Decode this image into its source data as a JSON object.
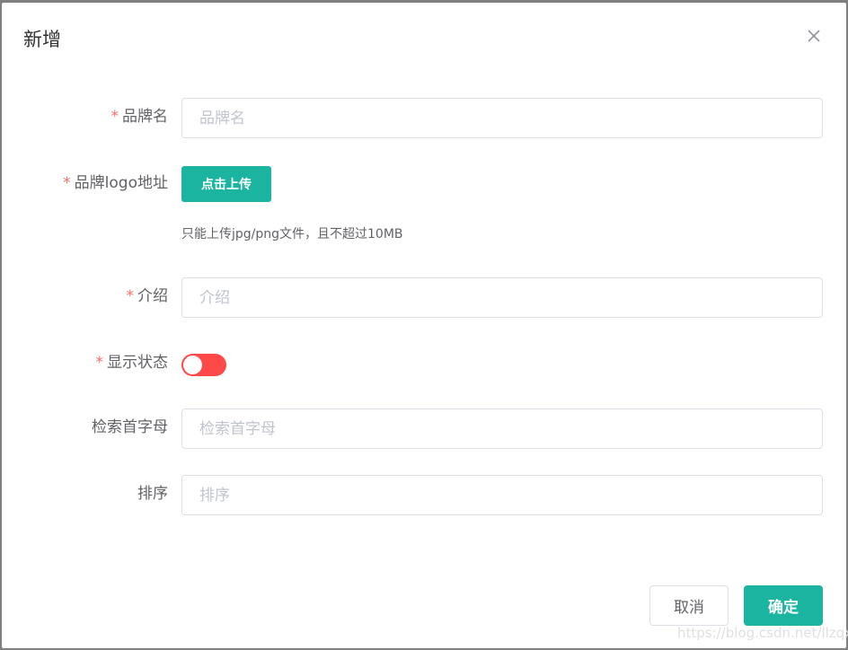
{
  "dialog": {
    "title": "新增",
    "close_icon": "close-icon"
  },
  "form": {
    "brand_name": {
      "required": "*",
      "label": "品牌名",
      "value": "",
      "placeholder": "品牌名"
    },
    "brand_logo": {
      "required": "*",
      "label": "品牌logo地址",
      "upload_button": "点击上传",
      "tip": "只能上传jpg/png文件，且不超过10MB"
    },
    "description": {
      "required": "*",
      "label": "介绍",
      "value": "",
      "placeholder": "介绍"
    },
    "show_status": {
      "required": "*",
      "label": "显示状态",
      "on": false,
      "color_off": "#ff4949"
    },
    "first_letter": {
      "label": "检索首字母",
      "value": "",
      "placeholder": "检索首字母"
    },
    "sort": {
      "label": "排序",
      "value": "",
      "placeholder": "排序"
    }
  },
  "footer": {
    "cancel_label": "取消",
    "confirm_label": "确定"
  },
  "watermark": "https://blog.csdn.net/llzqxl",
  "colors": {
    "primary": "#1bb4a0",
    "required": "#f56c6c"
  }
}
